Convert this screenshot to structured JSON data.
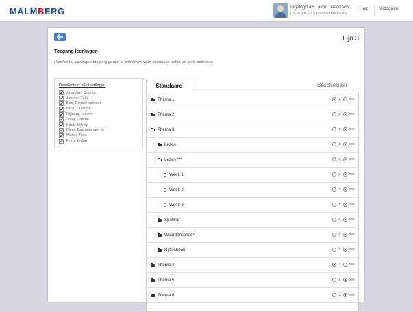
{
  "header": {
    "logo_main": "MALM",
    "logo_accent": "B",
    "logo_rest": "ERG",
    "user_name": "Ingelogd als Demo Leerkracht",
    "user_school": "(DEMO) U.M Demoschool Malmberg",
    "help_label": "Help",
    "logout_label": "Uitloggen"
  },
  "page": {
    "level": "Lijn 3",
    "title": "Toegang leerlingen",
    "description": "Hier kunt u leerlingen toegang geven of ontnemen voor sessies in oefen en toets software."
  },
  "students": {
    "deselect_label": "Deselecteer alle leerlingen",
    "list": [
      {
        "name": "Amazian, Dounia",
        "checked": true
      },
      {
        "name": "Amrani, Talal",
        "checked": true
      },
      {
        "name": "Bos, Esmee van der",
        "checked": true
      },
      {
        "name": "Bruin, Julia de",
        "checked": true
      },
      {
        "name": "Dijkstra, Maxim",
        "checked": true
      },
      {
        "name": "Jong, Cas de",
        "checked": true
      },
      {
        "name": "Kind, Jeffrey",
        "checked": true
      },
      {
        "name": "Meer, Bastiaan van der",
        "checked": true
      },
      {
        "name": "Meijer, Tess",
        "checked": true
      },
      {
        "name": "Prins, Dylan",
        "checked": true
      }
    ]
  },
  "tabs": {
    "standard": "Standaard",
    "available": "Beschikbaar"
  },
  "radio_labels": {
    "yes": "ja",
    "no": "nee"
  },
  "tree": [
    {
      "label": "Thema 1",
      "level": 0,
      "icon": "folder-closed-icon",
      "value": "ja"
    },
    {
      "label": "Thema 2",
      "level": 0,
      "icon": "folder-closed-icon",
      "value": "nee"
    },
    {
      "label": "Thema 3",
      "level": 0,
      "icon": "folder-open-icon",
      "value": "nee"
    },
    {
      "label": "Lezen",
      "level": 1,
      "icon": "folder-closed-icon",
      "value": "nee"
    },
    {
      "label": "Lezen ***",
      "level": 1,
      "icon": "folder-open-icon",
      "value": "nee"
    },
    {
      "label": "Week 1",
      "level": 2,
      "icon": "document-icon",
      "value": "nee"
    },
    {
      "label": "Week 2",
      "level": 2,
      "icon": "document-icon",
      "value": "nee"
    },
    {
      "label": "Week 3",
      "level": 2,
      "icon": "document-icon",
      "value": "nee"
    },
    {
      "label": "Spelling",
      "level": 1,
      "icon": "folder-closed-icon",
      "value": "nee"
    },
    {
      "label": "Woordenschat *",
      "level": 1,
      "icon": "folder-closed-icon",
      "value": "nee"
    },
    {
      "label": "Rijtjesboek",
      "level": 1,
      "icon": "folder-closed-icon",
      "value": "nee"
    },
    {
      "label": "Thema 4",
      "level": 0,
      "icon": "folder-closed-icon",
      "value": "ja"
    },
    {
      "label": "Thema 5",
      "level": 0,
      "icon": "folder-closed-icon",
      "value": "nee"
    },
    {
      "label": "Thema 6",
      "level": 0,
      "icon": "folder-closed-icon",
      "value": "nee"
    }
  ]
}
